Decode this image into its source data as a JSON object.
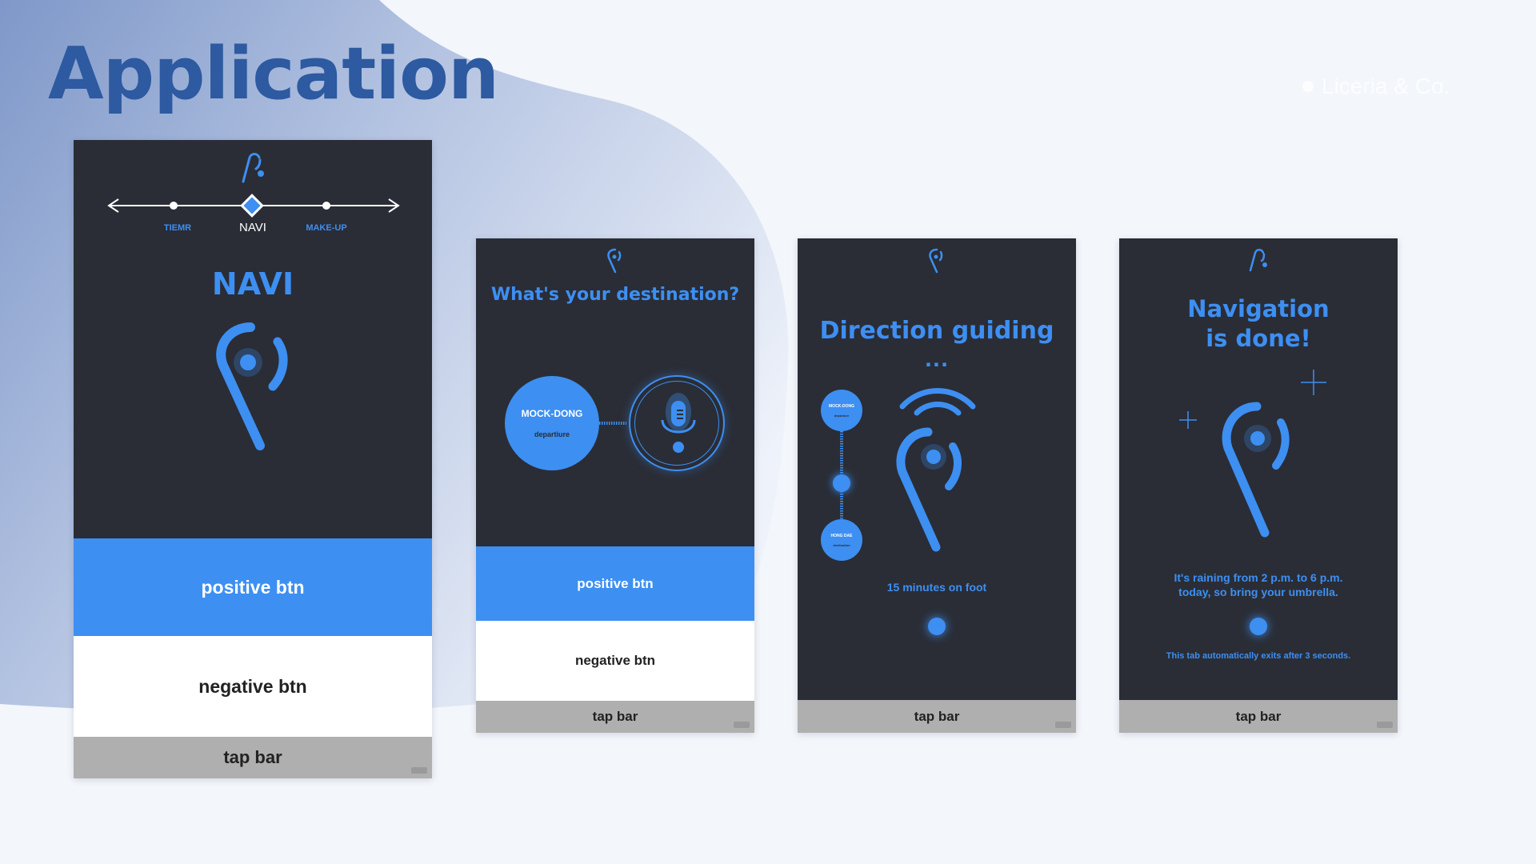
{
  "page": {
    "title": "Application",
    "brand": "Liceria & Co.",
    "colors": {
      "accent": "#3d8ff2",
      "screen_bg": "#2a2d36",
      "title": "#2d5aa0",
      "tapbar": "#afafaf"
    }
  },
  "screens": [
    {
      "id": "navi-main",
      "nav": {
        "left": "TIEMR",
        "center": "NAVI",
        "right": "MAKE-UP"
      },
      "heading": "NAVI",
      "positive_btn": "positive btn",
      "negative_btn": "negative btn",
      "tap_bar": "tap bar"
    },
    {
      "id": "destination",
      "heading": "What's your destination?",
      "origin_name": "MOCK-DONG",
      "origin_sub": "departiure",
      "positive_btn": "positive btn",
      "negative_btn": "negative btn",
      "tap_bar": "tap bar"
    },
    {
      "id": "direction",
      "heading": "Direction guiding",
      "ellipsis": "...",
      "start_name": "MOCK-DONG",
      "start_sub": "departure",
      "end_name": "HONG DAE",
      "end_sub": "destination",
      "duration": "15 minutes on foot",
      "tap_bar": "tap bar"
    },
    {
      "id": "done",
      "heading_line1": "Navigation",
      "heading_line2": "is done!",
      "message_line1": "It's raining from 2 p.m. to 6 p.m.",
      "message_line2": "today, so bring your umbrella.",
      "exit_note": "This tab automatically exits after 3 seconds.",
      "tap_bar": "tap bar"
    }
  ]
}
